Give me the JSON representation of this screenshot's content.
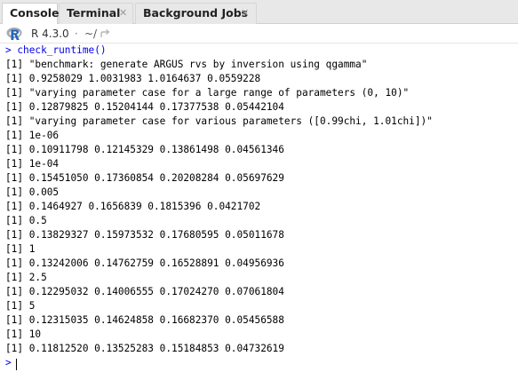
{
  "tabs": [
    {
      "label": "Console",
      "closable": false
    },
    {
      "label": "Terminal",
      "closable": true
    },
    {
      "label": "Background Jobs",
      "closable": true
    }
  ],
  "toolbar": {
    "r_version": "R 4.3.0",
    "separator": "·",
    "working_dir": "~/"
  },
  "console": {
    "prompt": ">",
    "command": "check_runtime()",
    "output": [
      "[1] \"benchmark: generate ARGUS rvs by inversion using qgamma\"",
      "[1] 0.9258029 1.0031983 1.0164637 0.0559228",
      "[1] \"varying parameter case for a large range of parameters (0, 10)\"",
      "[1] 0.12879825 0.15204144 0.17377538 0.05442104",
      "[1] \"varying parameter case for various parameters ([0.99chi, 1.01chi])\"",
      "[1] 1e-06",
      "[1] 0.10911798 0.12145329 0.13861498 0.04561346",
      "[1] 1e-04",
      "[1] 0.15451050 0.17360854 0.20208284 0.05697629",
      "[1] 0.005",
      "[1] 0.1464927 0.1656839 0.1815396 0.0421702",
      "[1] 0.5",
      "[1] 0.13829327 0.15973532 0.17680595 0.05011678",
      "[1] 1",
      "[1] 0.13242006 0.14762759 0.16528891 0.04956936",
      "[1] 2.5",
      "[1] 0.12295032 0.14006555 0.17024270 0.07061804",
      "[1] 5",
      "[1] 0.12315035 0.14624858 0.16682370 0.05456588",
      "[1] 10",
      "[1] 0.11812520 0.13525283 0.15184853 0.04732619"
    ]
  },
  "colors": {
    "prompt": "#0000ee",
    "output": "#000000",
    "tabbar_bg": "#e8e8e8"
  }
}
